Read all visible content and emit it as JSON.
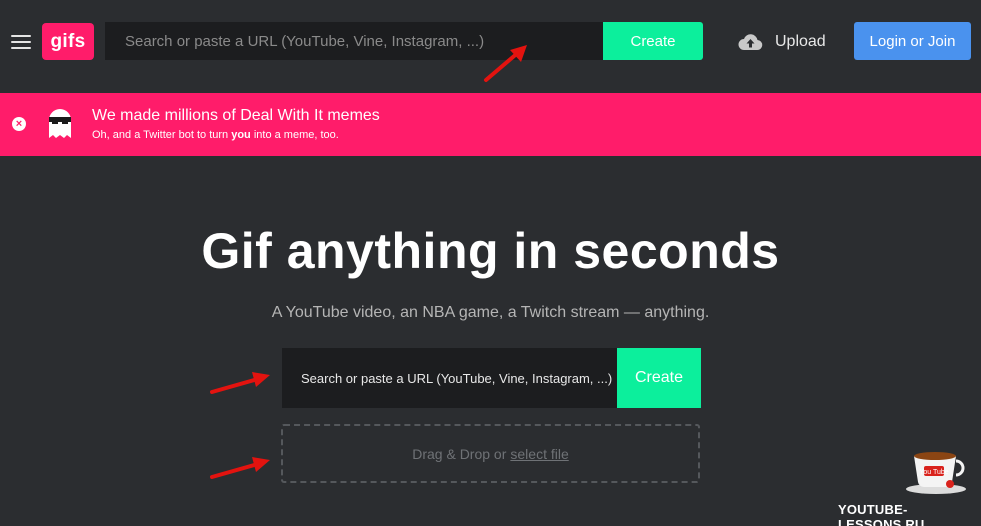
{
  "navbar": {
    "logo": "gifs",
    "search_placeholder": "Search or paste a URL (YouTube, Vine, Instagram, ...)",
    "create_label": "Create",
    "upload_label": "Upload",
    "login_label": "Login or Join"
  },
  "banner": {
    "title": "We made millions of Deal With It memes",
    "sub_before": "Oh, and a Twitter bot to turn ",
    "sub_bold": "you",
    "sub_after": " into a meme, too."
  },
  "hero": {
    "title": "Gif anything in seconds",
    "subtitle": "A YouTube video, an NBA game, a Twitch stream — anything.",
    "search_placeholder": "Search or paste a URL (YouTube, Vine, Instagram, ...)",
    "create_label": "Create",
    "dropzone_text": "Drag & Drop or",
    "dropzone_link": "select file"
  },
  "watermark": {
    "text": "YOUTUBE-LESSONS.RU",
    "cup_text": "You Tube"
  },
  "colors": {
    "background": "#2b2d30",
    "brand_pink": "#ff1c6a",
    "create_green": "#0cef9c",
    "login_blue": "#4a92ee",
    "arrow_red": "#e3130f"
  }
}
